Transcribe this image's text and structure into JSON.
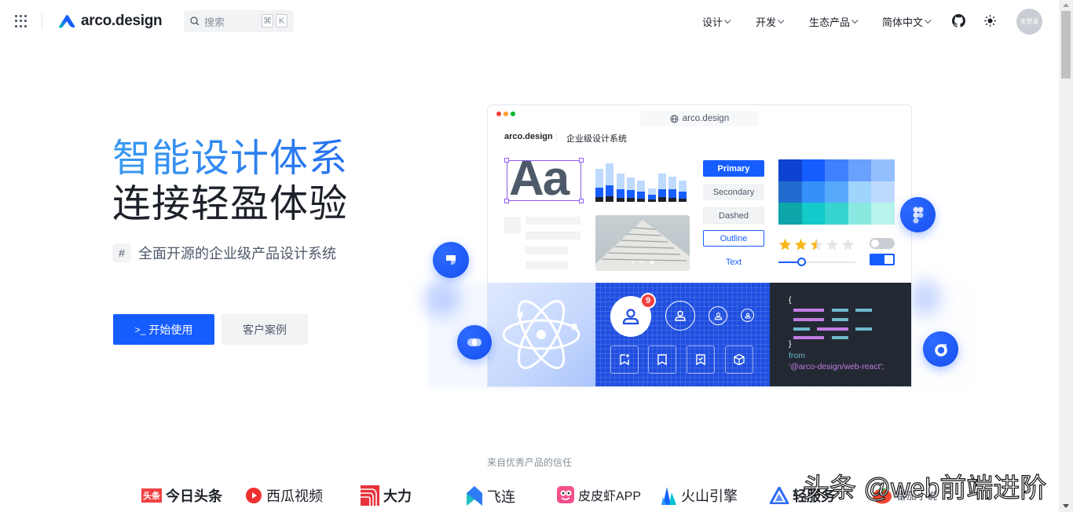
{
  "header": {
    "logo_text": "arco.design",
    "search": {
      "placeholder": "搜索",
      "shortcut_keys": [
        "⌘",
        "K"
      ]
    },
    "nav": [
      {
        "label": "设计"
      },
      {
        "label": "开发"
      },
      {
        "label": "生态产品"
      },
      {
        "label": "简体中文"
      }
    ],
    "icons": [
      "apps-grid-icon",
      "search-icon",
      "github-icon",
      "theme-sun-icon"
    ],
    "avatar_label": "未登录"
  },
  "hero": {
    "title_line1": "智能设计体系",
    "title_line2": "连接轻盈体验",
    "subtitle_hash": "#",
    "subtitle": "全面开源的企业级产品设计系统",
    "primary_button": {
      "icon": ">_",
      "label": "开始使用"
    },
    "secondary_button": {
      "label": "客户案例"
    }
  },
  "mockup": {
    "url": "arco.design",
    "logo": "arco.design",
    "tagline": "企业级设计系统",
    "typography_sample": "Aa",
    "buttons": [
      "Primary",
      "Secondary",
      "Dashed",
      "Outline",
      "Text"
    ],
    "palette_colors": [
      [
        "#0e42d2",
        "#165dff",
        "#4080ff",
        "#6aa1ff",
        "#94bfff"
      ],
      [
        "#206ccf",
        "#3491fa",
        "#57a9fb",
        "#9fd4fd",
        "#bedaff"
      ],
      [
        "#0da5aa",
        "#14c9c9",
        "#37d4cf",
        "#89e9e0",
        "#b7f4ec"
      ]
    ],
    "rating": {
      "value": 2.5,
      "max": 5
    },
    "slider_value_pct": 30,
    "switches": [
      {
        "state": "off"
      },
      {
        "state": "on"
      }
    ],
    "badge_count": "9",
    "carousel_dots": 3,
    "carousel_active": 3,
    "code": {
      "open": "{",
      "close": "}",
      "keyword": "from",
      "module": "'@arco-design/web-react';"
    },
    "colors": {
      "primary": "#165dff",
      "purple": "#c27de3",
      "cyan": "#6eb9cc",
      "warning": "#f7ba1e"
    }
  },
  "trust": {
    "title": "来自优秀产品的信任",
    "brands": [
      "今日头条",
      "西瓜视频",
      "大力",
      "飞连",
      "皮皮虾APP",
      "火山引擎",
      "轻服务",
      "番茄小说"
    ]
  },
  "watermark": "头条 @web前端进阶"
}
